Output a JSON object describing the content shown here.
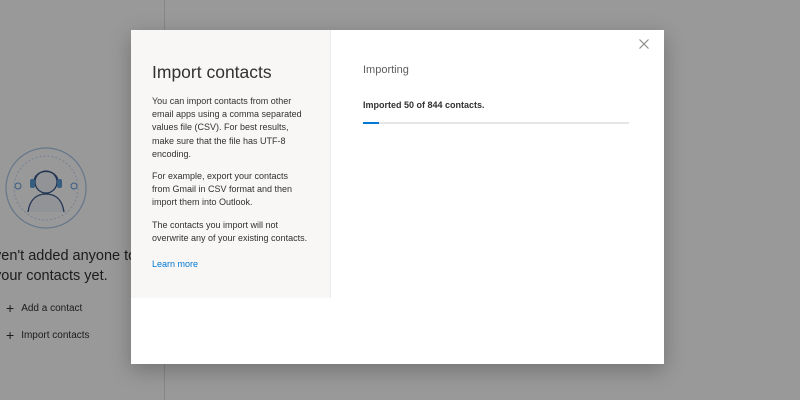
{
  "background": {
    "empty_line1": "ven't added anyone to",
    "empty_line2": "your contacts yet.",
    "actions": [
      {
        "label": "Add a contact"
      },
      {
        "label": "Import contacts"
      }
    ]
  },
  "dialog": {
    "title": "Import contacts",
    "descriptions": [
      "You can import contacts from other email apps using a comma separated values file (CSV). For best results, make sure that the file has UTF-8 encoding.",
      "For example, export your contacts from Gmail in CSV format and then import them into Outlook.",
      "The contacts you import will not overwrite any of your existing contacts."
    ],
    "learn_more": "Learn more",
    "status_title": "Importing",
    "progress_text": "Imported 50 of 844 contacts.",
    "progress": {
      "imported": 50,
      "total": 844
    },
    "close_icon": "close-icon"
  },
  "colors": {
    "accent": "#0078d4",
    "left_pane_bg": "#f8f7f6"
  }
}
